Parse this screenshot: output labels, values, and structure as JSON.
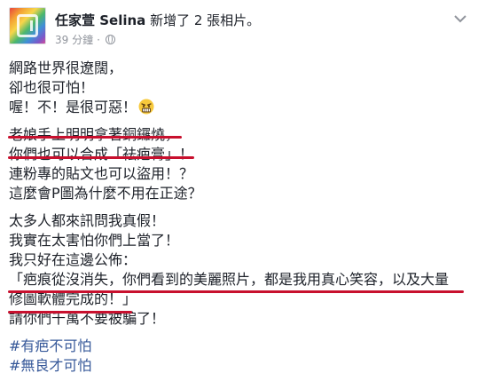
{
  "post": {
    "author": "任家萱 Selina",
    "action": "新增了 2 張相片。",
    "timestamp": "39 分鐘",
    "separator": "·",
    "audience_icon": "globe-icon",
    "options_icon": "chevron-down-icon"
  },
  "body": {
    "paragraph1": [
      "網路世界很遼闊，",
      "卻也很可怕！",
      "喔！不！是很可惡！"
    ],
    "emoji_icon": "angry-face-icon",
    "paragraph2": [
      "老娘手上明明拿著銅鑼燒，",
      "你們也可以合成「祛疤膏」！",
      "連粉專的貼文也可以盜用！？",
      "這麼會P圖為什麼不用在正途？"
    ],
    "paragraph3": [
      "太多人都來訊問我真假！",
      "我實在太害怕你們上當了！",
      "我只好在這邊公佈：",
      "「疤痕從沒消失，你們看到的美麗照片，都是我用真心笑容，以及大量",
      "修圖軟體完成的！」",
      "請你們千萬不要被騙了！"
    ],
    "hashtags": [
      "#有疤不可怕",
      "#無良才可怕"
    ]
  },
  "colors": {
    "annotation_underline": "#c8102e",
    "hashtag": "#365899",
    "meta": "#90949c"
  }
}
